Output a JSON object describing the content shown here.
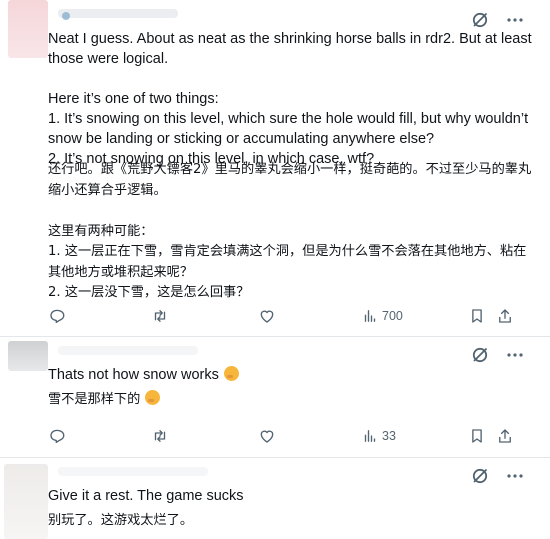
{
  "replies": [
    {
      "text_en": "Neat I guess. About as neat as the shrinking horse balls in rdr2. But at least those were logical.\n\nHere it’s one of two things:\n1. It’s snowing on this level, which sure the hole would fill, but why wouldn’t snow be landing or sticking or accumulating anywhere else?\n2. It’s not snowing on this level, in which case, wtf?",
      "text_cn": "还行吧。跟《荒野大镖客2》里马的睾丸会缩小一样，挺奇葩的。不过至少马的睾丸缩小还算合乎逻辑。\n\n这里有两种可能：\n1. 这一层正在下雪，雪肯定会填满这个洞，但是为什么雪不会落在其他地方、粘在其他地方或堆积起来呢？\n2. 这一层没下雪，这是怎么回事？",
      "views": "700"
    },
    {
      "text_en": "Thats not how snow works",
      "text_cn": "雪不是那样下的",
      "views": "33"
    },
    {
      "text_en": "Give it a rest. The game sucks",
      "text_cn": "别玩了。这游戏太烂了。"
    }
  ],
  "colors": {
    "icon": "#536471",
    "divider": "#e3e7ea",
    "text": "#0f1419",
    "emoji": "#f6b63b"
  },
  "icons": [
    "grok-icon",
    "more-icon",
    "reply-icon",
    "retweet-icon",
    "like-icon",
    "views-icon",
    "bookmark-icon",
    "share-icon"
  ]
}
